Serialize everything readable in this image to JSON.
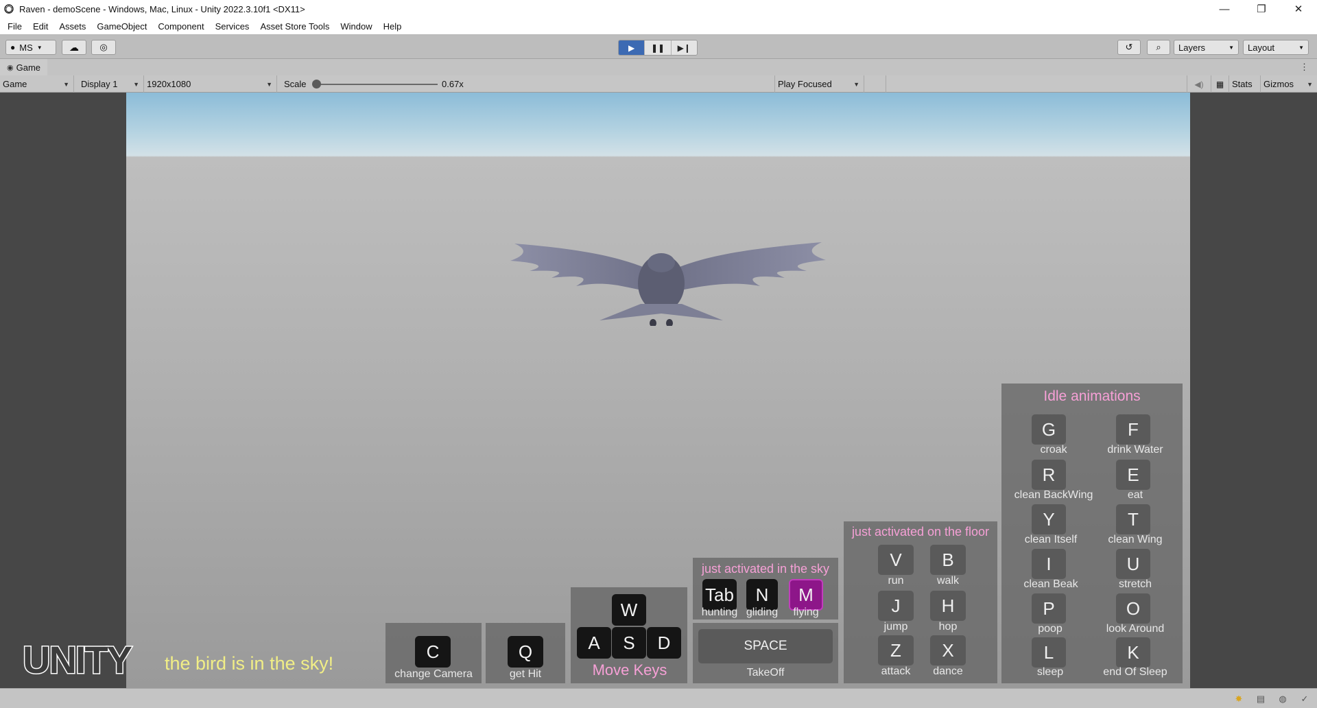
{
  "window": {
    "title": "Raven - demoScene - Windows, Mac, Linux - Unity 2022.3.10f1 <DX11>",
    "controls": {
      "minimize": "—",
      "restore": "❐",
      "close": "✕"
    }
  },
  "menubar": {
    "items": [
      "File",
      "Edit",
      "Assets",
      "GameObject",
      "Component",
      "Services",
      "Asset Store Tools",
      "Window",
      "Help"
    ]
  },
  "toolbar": {
    "account_label": "MS",
    "layers_label": "Layers",
    "layout_label": "Layout"
  },
  "game_tab": {
    "label": "Game"
  },
  "game_bar": {
    "view_mode": "Game",
    "display": "Display 1",
    "resolution": "1920x1080",
    "scale_label": "Scale",
    "scale_value": "0.67x",
    "play_mode": "Play Focused",
    "stats_label": "Stats",
    "gizmos_label": "Gizmos"
  },
  "hud": {
    "status_text": "the bird is in the sky!",
    "logo_text": "UNITY",
    "change_camera": {
      "key": "C",
      "label": "change Camera"
    },
    "get_hit": {
      "key": "Q",
      "label": "get Hit"
    },
    "move_keys": {
      "keys": [
        "W",
        "A",
        "S",
        "D"
      ],
      "label": "Move Keys"
    },
    "sky": {
      "title": "just activated in the sky",
      "keys": [
        {
          "key": "Tab",
          "label": "hunting"
        },
        {
          "key": "N",
          "label": "gliding"
        },
        {
          "key": "M",
          "label": "flying",
          "active": true
        }
      ]
    },
    "space": {
      "key": "SPACE",
      "label": "TakeOff"
    },
    "floor": {
      "title": "just activated on the floor",
      "keys": [
        {
          "key": "V",
          "label": "run"
        },
        {
          "key": "B",
          "label": "walk"
        },
        {
          "key": "J",
          "label": "jump"
        },
        {
          "key": "H",
          "label": "hop"
        },
        {
          "key": "Z",
          "label": "attack"
        },
        {
          "key": "X",
          "label": "dance"
        }
      ]
    },
    "idle": {
      "title": "Idle animations",
      "keys": [
        {
          "key": "G",
          "label": "croak"
        },
        {
          "key": "F",
          "label": "drink Water"
        },
        {
          "key": "R",
          "label": "clean BackWing"
        },
        {
          "key": "E",
          "label": "eat"
        },
        {
          "key": "Y",
          "label": "clean Itself"
        },
        {
          "key": "T",
          "label": "clean Wing"
        },
        {
          "key": "I",
          "label": "clean Beak"
        },
        {
          "key": "U",
          "label": "stretch"
        },
        {
          "key": "P",
          "label": "poop"
        },
        {
          "key": "O",
          "label": "look Around"
        },
        {
          "key": "L",
          "label": "sleep"
        },
        {
          "key": "K",
          "label": "end Of Sleep"
        }
      ]
    }
  },
  "colors": {
    "play_active": "#3c6ab3",
    "key_active": "#8d1689",
    "panel_title": "#f6a0d6",
    "status_text": "#f1ee86"
  }
}
